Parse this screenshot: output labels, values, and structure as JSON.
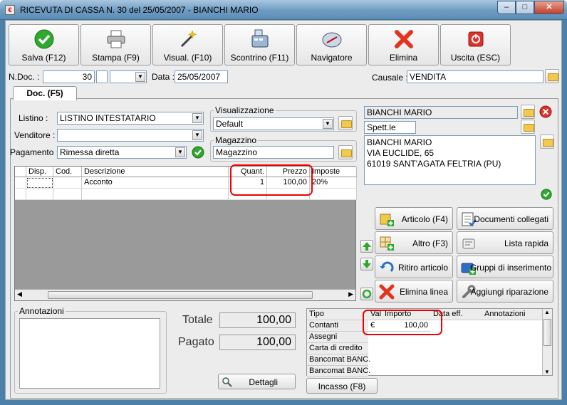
{
  "window": {
    "title": "RICEVUTA DI CASSA N. 30  del 25/05/2007  - BIANCHI MARIO",
    "controls": [
      "–",
      "□",
      "✕"
    ]
  },
  "toolbar": [
    {
      "label": "Salva (F12)",
      "icon": "check-icon"
    },
    {
      "label": "Stampa (F9)",
      "icon": "printer-icon"
    },
    {
      "label": "Visual. (F10)",
      "icon": "magic-wand-icon"
    },
    {
      "label": "Scontrino (F11)",
      "icon": "cash-register-icon"
    },
    {
      "label": "Navigatore",
      "icon": "compass-icon"
    },
    {
      "label": "Elimina",
      "icon": "delete-x-icon"
    },
    {
      "label": "Uscita (ESC)",
      "icon": "exit-icon"
    }
  ],
  "header": {
    "ndoc_label": "N.Doc. :",
    "ndoc_value": "30",
    "ndoc_suffix": "",
    "data_label": "Data :",
    "data_value": "25/05/2007",
    "causale_label": "Causale :",
    "causale_value": "VENDITA"
  },
  "tab": {
    "label": "Doc. (F5)"
  },
  "form": {
    "listino_label": "Listino :",
    "listino_value": "LISTINO INTESTATARIO",
    "venditore_label": "Venditore :",
    "venditore_value": "",
    "pagamento_label": "Pagamento :",
    "pagamento_value": "Rimessa diretta",
    "visualizzazione_title": "Visualizzazione",
    "visualizzazione_value": "Default",
    "magazzino_title": "Magazzino",
    "magazzino_value": "Magazzino"
  },
  "customer": {
    "name": "BIANCHI MARIO",
    "title": "Spett.le",
    "address_lines": [
      "BIANCHI MARIO",
      "VIA EUCLIDE, 65",
      "61019 SANT'AGATA FELTRIA (PU)"
    ]
  },
  "grid": {
    "columns": [
      "Disp.",
      "Cod.",
      "Descrizione",
      "Quant.",
      "Prezzo",
      "Imposte"
    ],
    "rows": [
      {
        "disp": "",
        "cod": "",
        "descrizione": "Acconto",
        "quant": "1",
        "prezzo": "100,00",
        "imposte": "20%"
      }
    ]
  },
  "actions": [
    {
      "label": "Articolo (F4)",
      "icon": "article-add-icon"
    },
    {
      "label": "Documenti collegati",
      "icon": "linked-documents-icon"
    },
    {
      "label": "Altro (F3)",
      "icon": "grid-add-icon"
    },
    {
      "label": "Lista rapida",
      "icon": "quick-list-icon"
    },
    {
      "label": "Ritiro articolo",
      "icon": "return-article-icon"
    },
    {
      "label": "Gruppi di inserimento",
      "icon": "insert-groups-icon"
    },
    {
      "label": "Elimina linea",
      "icon": "delete-line-icon"
    },
    {
      "label": "Aggiungi riparazione",
      "icon": "wrench-icon"
    }
  ],
  "annotazioni": {
    "label": "Annotazioni",
    "value": ""
  },
  "totals": {
    "totale_label": "Totale",
    "totale_value": "100,00",
    "pagato_label": "Pagato",
    "pagato_value": "100,00",
    "dettagli_label": "Dettagli"
  },
  "payments": {
    "columns": [
      "Tipo",
      "Val",
      "Importo",
      "Data eff.",
      "Annotazioni"
    ],
    "rows": [
      {
        "tipo": "Contanti",
        "val": "€",
        "importo": "100,00"
      },
      {
        "tipo": "Assegni",
        "val": "",
        "importo": ""
      },
      {
        "tipo": "Carta di credito",
        "val": "",
        "importo": ""
      },
      {
        "tipo": "Bancomat BANC.",
        "val": "",
        "importo": ""
      },
      {
        "tipo": "Bancomat BANC.",
        "val": "",
        "importo": ""
      }
    ],
    "incasso_label": "Incasso (F8)"
  },
  "colors": {
    "highlight": "#e00000",
    "accent_green": "#2e9b2e",
    "title_blue": "#6e9bc2"
  }
}
